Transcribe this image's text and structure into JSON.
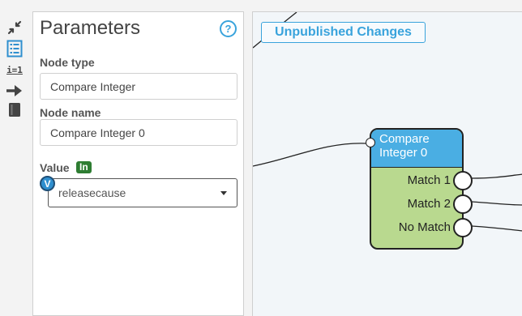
{
  "toolbar": {
    "items": [
      {
        "name": "collapse-icon"
      },
      {
        "name": "parameters-list-icon"
      },
      {
        "name": "assign-icon",
        "text": "i=1"
      },
      {
        "name": "arrow-right-icon"
      },
      {
        "name": "book-icon"
      }
    ]
  },
  "panel": {
    "title": "Parameters",
    "help_icon": "?",
    "node_type": {
      "label": "Node type",
      "value": "Compare Integer"
    },
    "node_name": {
      "label": "Node name",
      "value": "Compare Integer 0"
    },
    "value": {
      "label": "Value",
      "badge": "In",
      "v_badge": "V",
      "selected": "releasecause"
    }
  },
  "canvas": {
    "status_button": "Unpublished Changes",
    "node": {
      "title_line1": "Compare",
      "title_line2": "Integer 0",
      "ports": [
        {
          "label": "Match 1"
        },
        {
          "label": "Match 2"
        },
        {
          "label": "No Match"
        }
      ]
    }
  },
  "colors": {
    "accent": "#39a3dc",
    "node_header": "#4aaee3",
    "node_body": "#b9d98f",
    "in_badge": "#2e7d32"
  }
}
